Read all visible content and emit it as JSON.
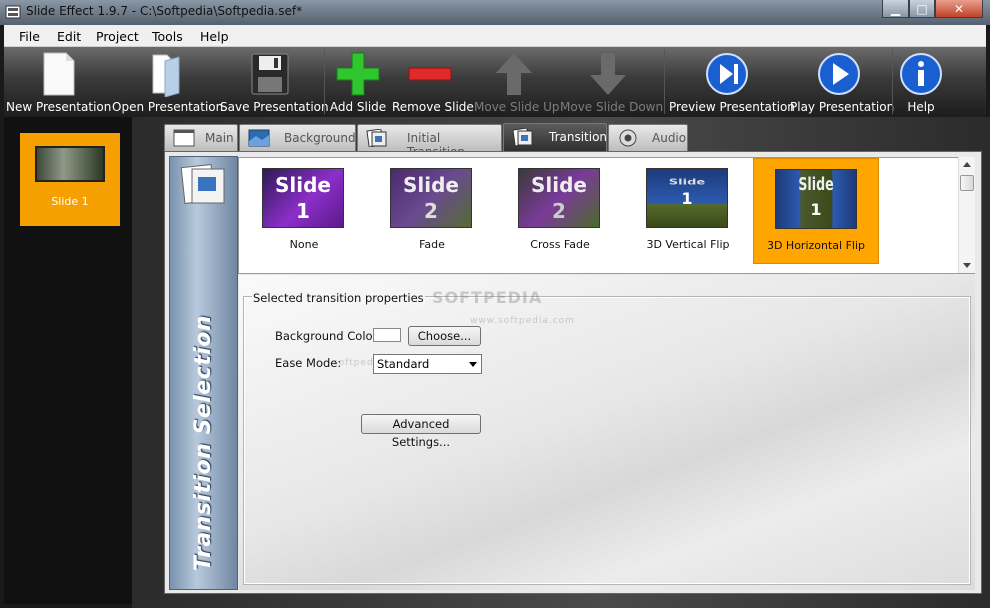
{
  "window": {
    "title": "Slide Effect 1.9.7 - C:\\Softpedia\\Softpedia.sef*"
  },
  "menu": [
    "File",
    "Edit",
    "Project",
    "Tools",
    "Help"
  ],
  "toolbar": {
    "new_presentation": "New Presentation",
    "open_presentation": "Open Presentation",
    "save_presentation": "Save Presentation",
    "add_slide": "Add Slide",
    "remove_slide": "Remove Slide",
    "move_slide_up": "Move Slide Up",
    "move_slide_down": "Move Slide Down",
    "preview_presentation": "Preview Presentation",
    "play_presentation": "Play Presentation",
    "help": "Help"
  },
  "slides": [
    {
      "label": "Slide 1"
    }
  ],
  "tabs": [
    "Main",
    "Background",
    "Initial Transition",
    "Transition",
    "Audio"
  ],
  "active_tab": "Transition",
  "sidebar_heading": "Transition Selection",
  "transitions": [
    {
      "name": "None",
      "thumb_text": "Slide",
      "thumb_num": "1"
    },
    {
      "name": "Fade",
      "thumb_text": "Slide",
      "thumb_num": "2"
    },
    {
      "name": "Cross Fade",
      "thumb_text": "Slide",
      "thumb_num": "2"
    },
    {
      "name": "3D Vertical Flip",
      "thumb_text": "Slide",
      "thumb_num": "1"
    },
    {
      "name": "3D Horizontal Flip",
      "thumb_text": "Slide",
      "thumb_num": "1",
      "selected": true
    }
  ],
  "properties": {
    "group_label": "Selected transition properties",
    "background_color_label": "Background Color:",
    "choose_button": "Choose...",
    "ease_mode_label": "Ease Mode:",
    "ease_mode_value": "Standard",
    "advanced_button": "Advanced Settings..."
  },
  "watermarks": {
    "main": "SOFTPEDIA",
    "url": "www.softpedia.com",
    "small": "softpedia"
  },
  "colors": {
    "accent": "#ffa500",
    "blue_panel": "#8aa0bb"
  }
}
